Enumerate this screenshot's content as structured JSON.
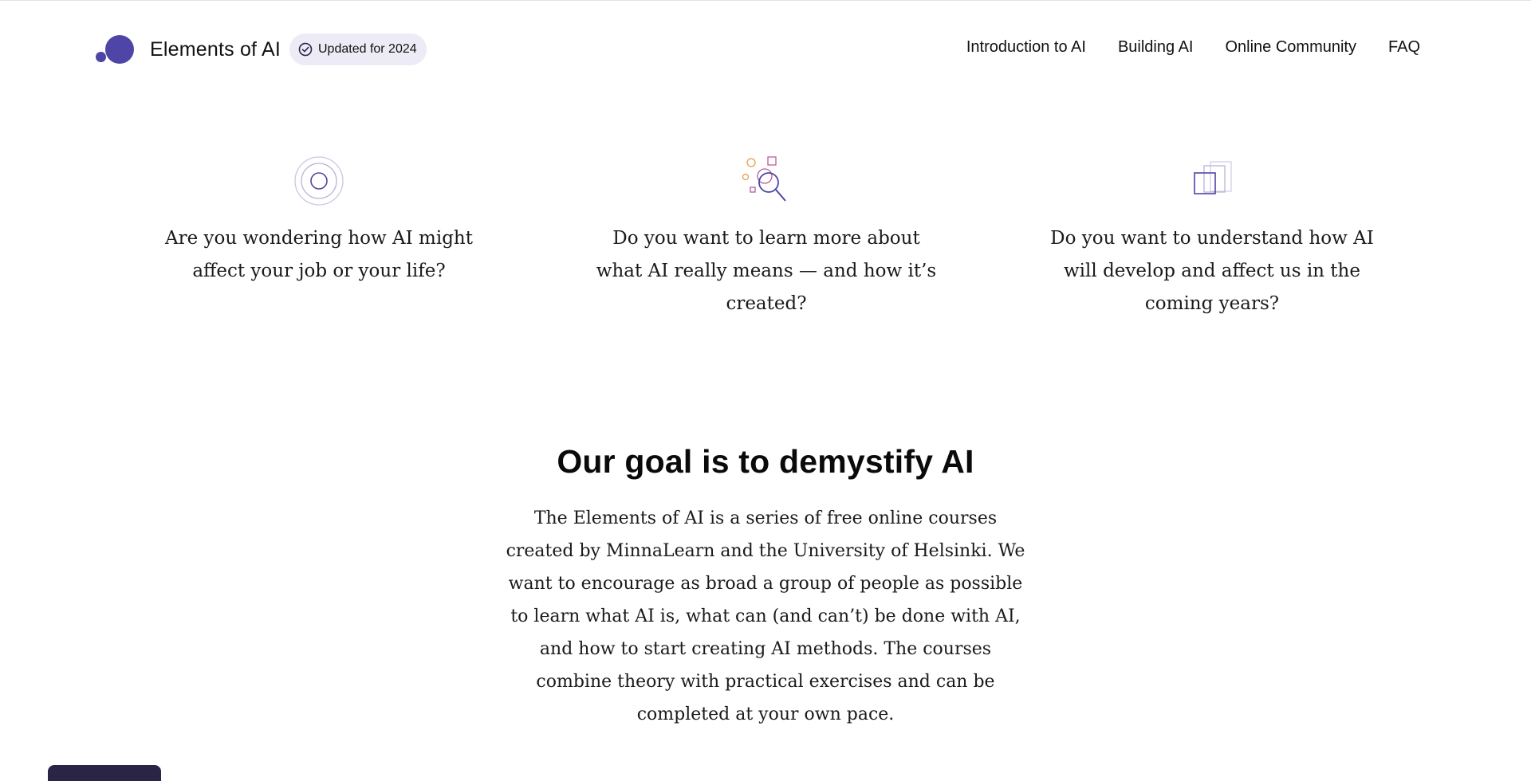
{
  "header": {
    "brand_name": "Elements of AI",
    "badge_label": "Updated for 2024",
    "nav": [
      {
        "label": "Introduction to AI"
      },
      {
        "label": "Building AI"
      },
      {
        "label": "Online Community"
      },
      {
        "label": "FAQ"
      }
    ]
  },
  "features": [
    {
      "icon": "target-icon",
      "text": "Are you wondering how AI might affect your job or your life?"
    },
    {
      "icon": "magnifier-shapes-icon",
      "text": "Do you want to learn more about what AI really means — and how it’s created?"
    },
    {
      "icon": "stacked-squares-icon",
      "text": "Do you want to understand how AI will develop and affect us in the coming years?"
    }
  ],
  "goal": {
    "title": "Our goal is to demystify AI",
    "text": "The Elements of AI is a series of free online courses created by MinnaLearn and the University of Helsinki. We want to encourage as broad a group of people as possible to learn what AI is, what can (and can’t) be done with AI, and how to start creating AI methods. The courses combine theory with practical exercises and can be completed at your own pace."
  },
  "colors": {
    "brand": "#4e45a6",
    "badge_bg": "#ecebf6",
    "icon_purple": "#6b5fb5",
    "icon_orange": "#e2a04a",
    "icon_pink": "#b65f9c",
    "icon_light": "#b9b4d9",
    "bottom_tab": "#2b2545"
  }
}
